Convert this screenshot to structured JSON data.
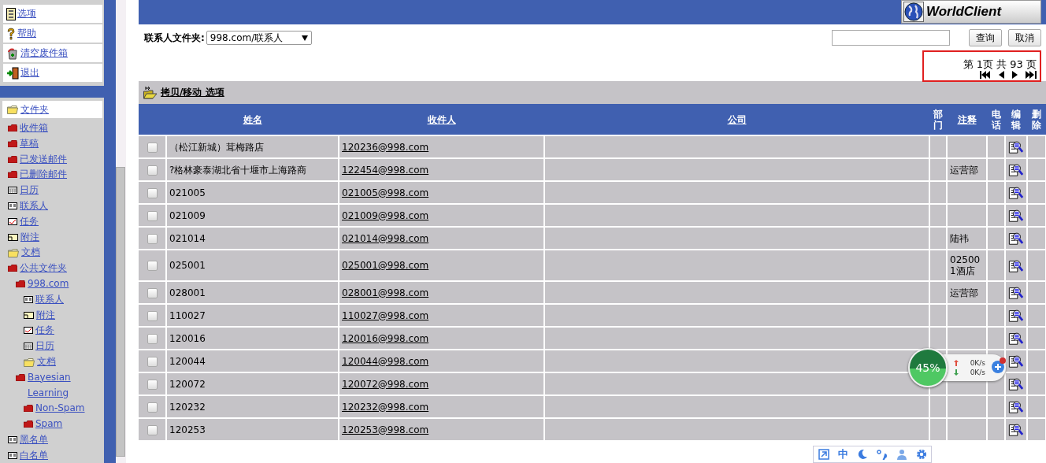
{
  "sidebar": {
    "menu": [
      {
        "label": "选项",
        "kind": "options"
      },
      {
        "label": "帮助",
        "kind": "help"
      },
      {
        "label": "清空废件箱",
        "kind": "trash"
      },
      {
        "label": "退出",
        "kind": "exit"
      }
    ],
    "folders_header": {
      "label": "文件夹",
      "kind": "folder"
    },
    "folders": [
      {
        "label": "收件箱",
        "kind": "mail"
      },
      {
        "label": "草稿",
        "kind": "mail"
      },
      {
        "label": "已发送邮件",
        "kind": "mail"
      },
      {
        "label": "已删除邮件",
        "kind": "mail"
      },
      {
        "label": "日历",
        "kind": "calendar"
      },
      {
        "label": "联系人",
        "kind": "contacts"
      },
      {
        "label": "任务",
        "kind": "tasks"
      },
      {
        "label": "附注",
        "kind": "notes"
      },
      {
        "label": "文档",
        "kind": "folder"
      },
      {
        "label": "公共文件夹",
        "kind": "mail",
        "children": [
          {
            "label": "998.com",
            "kind": "mail",
            "children": [
              {
                "label": "联系人",
                "kind": "contacts"
              },
              {
                "label": "附注",
                "kind": "notes"
              },
              {
                "label": "任务",
                "kind": "tasks"
              },
              {
                "label": "日历",
                "kind": "calendar"
              },
              {
                "label": "文档",
                "kind": "folder"
              }
            ]
          },
          {
            "label": "Bayesian Learning",
            "kind": "mail",
            "children": [
              {
                "label": "Non-Spam",
                "kind": "mail"
              },
              {
                "label": "Spam",
                "kind": "mail"
              }
            ]
          }
        ]
      },
      {
        "label": "黑名单",
        "kind": "contacts"
      },
      {
        "label": "白名单",
        "kind": "contacts"
      }
    ]
  },
  "header": {
    "logo": "WorldClient"
  },
  "toolbar": {
    "folder_label": "联系人文件夹:",
    "folder_value": "998.com/联系人",
    "buttons": [
      "查询",
      "取消"
    ]
  },
  "pagination": {
    "text": "第 1页 共 93 页"
  },
  "action_link": "拷贝/移动 选项",
  "table": {
    "columns": [
      {
        "kind": "check"
      },
      {
        "label": "姓名",
        "kind": "sortable"
      },
      {
        "label": "收件人",
        "kind": "sortable"
      },
      {
        "label": "公司",
        "kind": "sortable"
      },
      {
        "label": "部门",
        "kind": "plain"
      },
      {
        "label": "注释",
        "kind": "sortable"
      },
      {
        "label": "电话",
        "kind": "plain"
      },
      {
        "label": "编辑",
        "kind": "plain"
      },
      {
        "label": "删除",
        "kind": "plain"
      }
    ],
    "rows": [
      {
        "checked": false,
        "name": "（松江新城）茸梅路店",
        "email": "120236@998.com",
        "note": ""
      },
      {
        "checked": false,
        "name": "?格林豪泰湖北省十堰市上海路商",
        "email": "122454@998.com",
        "note": "运营部"
      },
      {
        "checked": false,
        "name": "021005",
        "email": "021005@998.com",
        "note": ""
      },
      {
        "checked": false,
        "name": "021009",
        "email": "021009@998.com",
        "note": ""
      },
      {
        "checked": false,
        "name": "021014",
        "email": "021014@998.com",
        "note": "陆祎"
      },
      {
        "checked": false,
        "name": "025001",
        "email": "025001@998.com",
        "note": "025001酒店"
      },
      {
        "checked": false,
        "name": "028001",
        "email": "028001@998.com",
        "note": "运营部"
      },
      {
        "checked": false,
        "name": "110027",
        "email": "110027@998.com",
        "note": ""
      },
      {
        "checked": false,
        "name": "120016",
        "email": "120016@998.com",
        "note": ""
      },
      {
        "checked": false,
        "name": "120044",
        "email": "120044@998.com",
        "note": ""
      },
      {
        "checked": false,
        "name": "120072",
        "email": "120072@998.com",
        "note": ""
      },
      {
        "checked": false,
        "name": "120232",
        "email": "120232@998.com",
        "note": ""
      },
      {
        "checked": false,
        "name": "120253",
        "email": "120253@998.com",
        "note": ""
      }
    ]
  },
  "speed_widget": {
    "percent": "45%",
    "upload": "0K/s",
    "download": "0K/s"
  },
  "ime_bar": {
    "mode": "中"
  }
}
